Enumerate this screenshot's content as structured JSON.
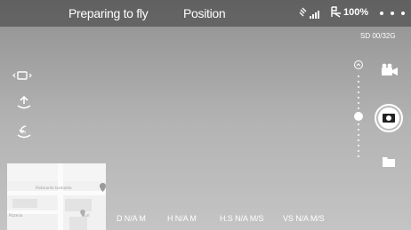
{
  "status_bar": {
    "flight_status": "Preparing to fly",
    "gps_mode": "Position",
    "battery_percent": "100%",
    "signal_icon": "satellite-signal-icon",
    "battery_icon": "aircraft-battery-icon",
    "more_icon": "more-dots-icon"
  },
  "storage": {
    "sd_status": "SD 00/32G"
  },
  "left_controls": {
    "gimbal_icon": "gimbal-mode-icon",
    "takeoff_icon": "takeoff-icon",
    "return_home_icon": "return-home-icon"
  },
  "right_controls": {
    "camera_mode_icon": "video-camera-icon",
    "shutter_icon": "shutter-camera-icon",
    "playback_icon": "folder-icon",
    "zoom_icon": "zoom-icon"
  },
  "map": {
    "labels": [
      "Ristorante Isamanto",
      "Pizzeria",
      "Ourl"
    ]
  },
  "telemetry": {
    "distance": "D N/A M",
    "height": "H N/A M",
    "horizontal_speed": "H.S N/A M/S",
    "vertical_speed": "VS  N/A M/S"
  },
  "colors": {
    "status_bar_bg": "#3c3c3c",
    "sky_top": "#8e8e8e",
    "sky_bottom": "#c4c4c4",
    "text": "#ffffff"
  }
}
